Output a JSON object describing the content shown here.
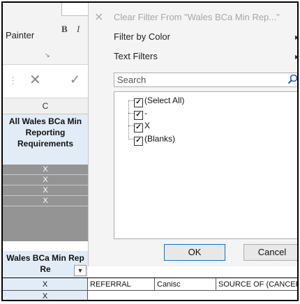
{
  "ribbon": {
    "painter_label": "Painter",
    "bold_label": "B",
    "italic_label": "I",
    "launcher_glyph": "↘"
  },
  "formula_bar": {
    "menu_glyph": "⋮",
    "cancel_glyph": "✕",
    "confirm_glyph": "✓"
  },
  "sheet": {
    "column_letter": "C",
    "header_text": "All Wales BCa Min Reporting Requirements",
    "x_values": [
      "X",
      "X",
      "X",
      "X"
    ],
    "wales_header": "Wales BCa Min Rep Re",
    "filter_glyph": "▼"
  },
  "bottom_row": {
    "cells": [
      "X",
      "REFERRAL",
      "Canisc",
      "SOURCE OF (CANCER"
    ],
    "second_x": "X"
  },
  "filter_menu": {
    "clear_filter": "Clear Filter From \"Wales BCa Min Rep...\"",
    "filter_by_color": "Filter by Color",
    "text_filters": "Text Filters",
    "search_placeholder": "Search",
    "items": [
      {
        "label": "(Select All)",
        "checked": true
      },
      {
        "label": "-",
        "checked": true
      },
      {
        "label": "X",
        "checked": true
      },
      {
        "label": "(Blanks)",
        "checked": true
      }
    ],
    "ok_label": "OK",
    "cancel_label": "Cancel"
  },
  "colors": {
    "header_blue": "#e1ecf7",
    "x_cell_grey": "#949494",
    "panel_bg": "#f4f4f4",
    "ok_border": "#0078d7"
  }
}
